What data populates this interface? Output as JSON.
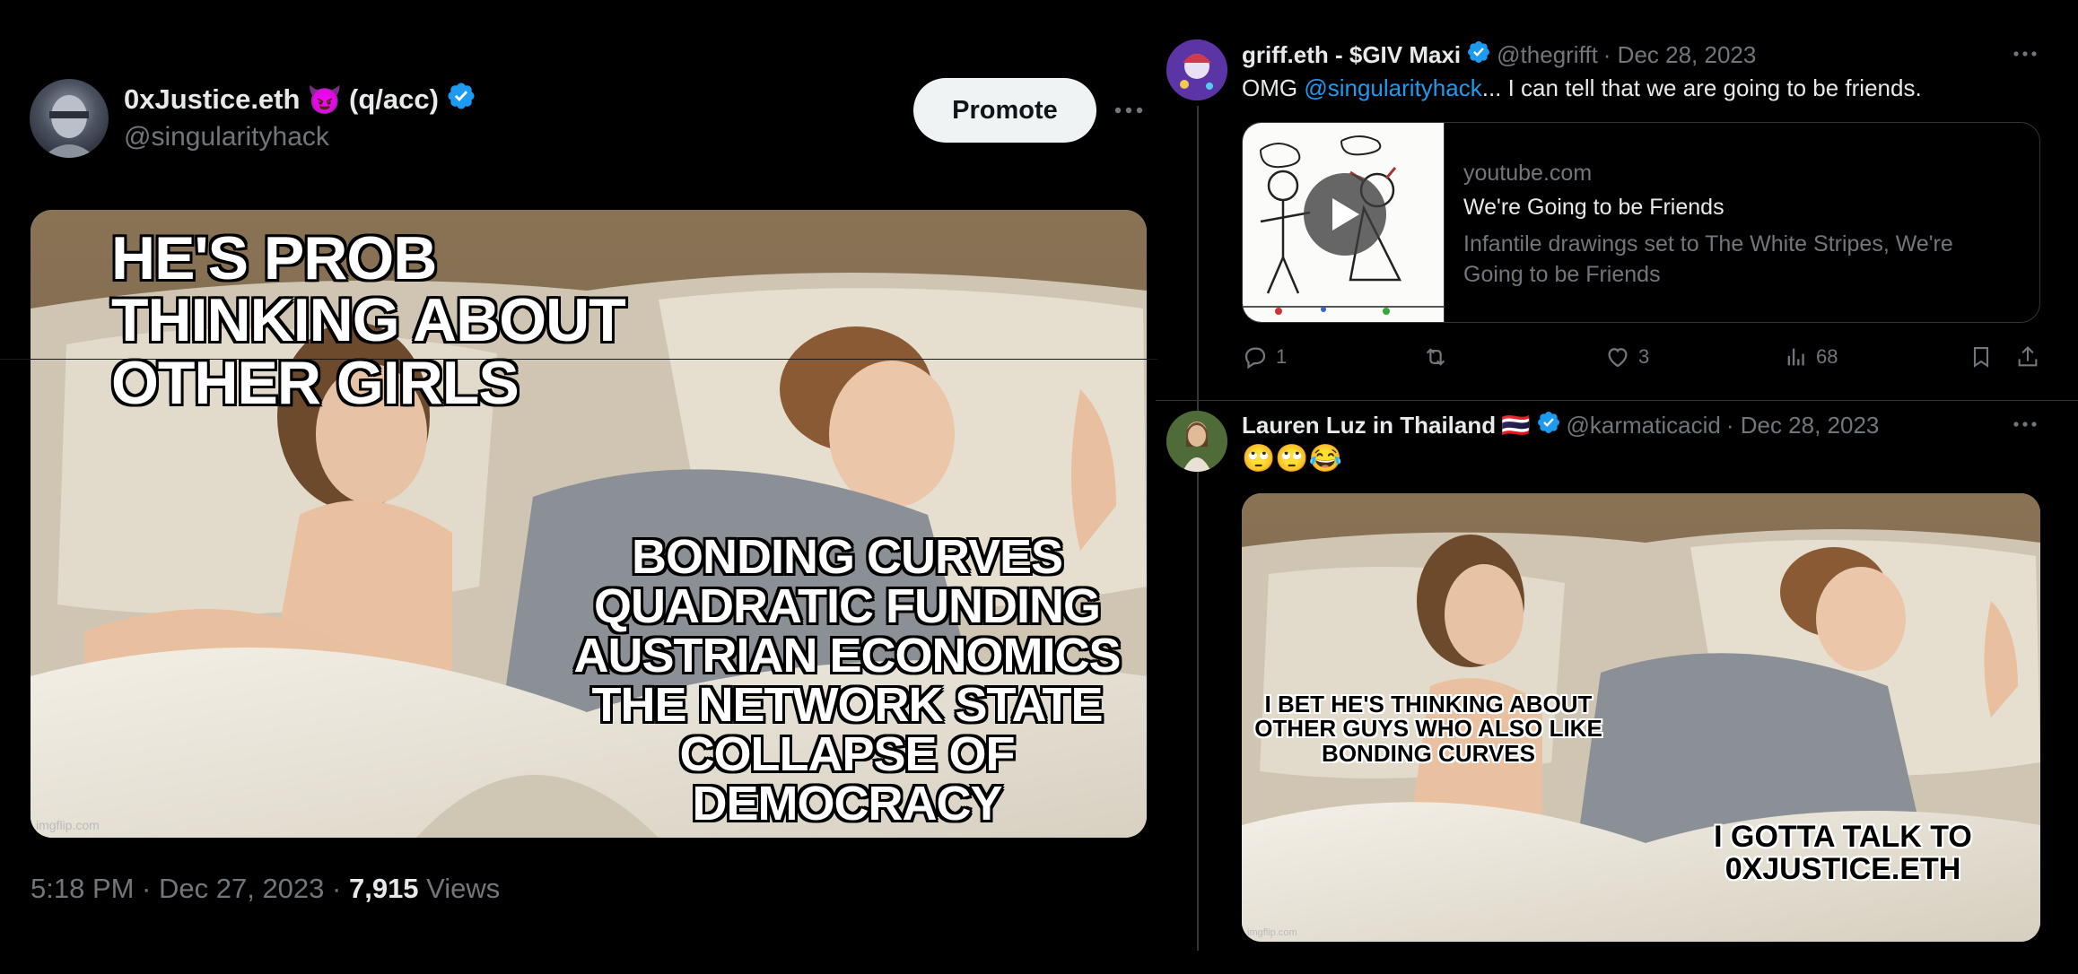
{
  "main_tweet": {
    "display_name": "0xJustice.eth",
    "name_emoji": "😈",
    "name_suffix": "(q/acc)",
    "handle": "@singularityhack",
    "promote_label": "Promote",
    "meme": {
      "top_text": "HE'S PROB THINKING ABOUT OTHER GIRLS",
      "bottom_lines": [
        "BONDING CURVES",
        "QUADRATIC FUNDING",
        "AUSTRIAN ECONOMICS",
        "THE NETWORK STATE",
        "COLLAPSE OF DEMOCRACY"
      ],
      "watermark": "imgflip.com"
    },
    "time": "5:18 PM · Dec 27, 2023 · ",
    "views_count": "7,915",
    "views_label": "Views"
  },
  "reply1": {
    "display_name": "griff.eth - $GIV Maxi",
    "handle": "@thegrifft",
    "date": "· Dec 28, 2023",
    "text_prefix": "OMG ",
    "mention": "@singularityhack",
    "text_suffix": "... I can tell that we are going to be friends.",
    "card": {
      "domain": "youtube.com",
      "title": "We're Going to be Friends",
      "description": "Infantile drawings set to The White Stripes, We're Going to be Friends"
    },
    "actions": {
      "replies": "1",
      "retweets": "",
      "likes": "3",
      "views": "68"
    }
  },
  "reply2": {
    "display_name": "Lauren Luz in Thailand",
    "flag": "🇹🇭",
    "handle": "@karmaticacid",
    "date": "· Dec 28, 2023",
    "text": "🙄🙄😂",
    "meme": {
      "left_text": "I BET HE'S THINKING ABOUT OTHER GUYS WHO ALSO LIKE BONDING CURVES",
      "right_text": "I GOTTA TALK TO 0XJUSTICE.ETH",
      "watermark": "imgflip.com"
    }
  },
  "colors": {
    "accent": "#1d9bf0",
    "muted": "#71767b",
    "text": "#e7e9ea",
    "background": "#000000"
  },
  "icons": [
    "verified-badge-icon",
    "more-icon",
    "reply-icon",
    "retweet-icon",
    "like-icon",
    "views-icon",
    "bookmark-icon",
    "share-icon",
    "play-icon"
  ]
}
